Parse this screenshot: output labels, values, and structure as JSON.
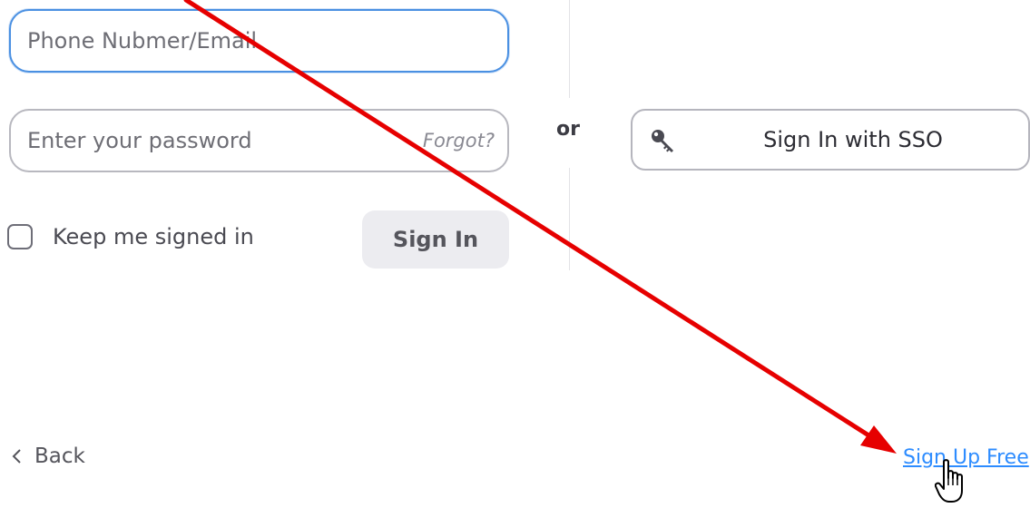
{
  "login": {
    "email_placeholder": "Phone Nubmer/Email",
    "password_placeholder": "Enter your password",
    "forgot_label": "Forgot?",
    "keep_signed_in_label": "Keep me signed in",
    "keep_signed_in_checked": false,
    "sign_in_label": "Sign In"
  },
  "divider": {
    "or_label": "or"
  },
  "sso": {
    "label": "Sign In with SSO",
    "icon": "key-icon"
  },
  "footer": {
    "back_label": "Back",
    "back_icon": "chevron-left-icon",
    "signup_label": "Sign Up Free"
  },
  "overlay": {
    "arrow_color": "#e60000",
    "cursor_icon": "hand-pointer-icon"
  },
  "colors": {
    "accent": "#2d8cff",
    "focus_border": "#4a90e2",
    "button_bg": "#ececf0"
  }
}
